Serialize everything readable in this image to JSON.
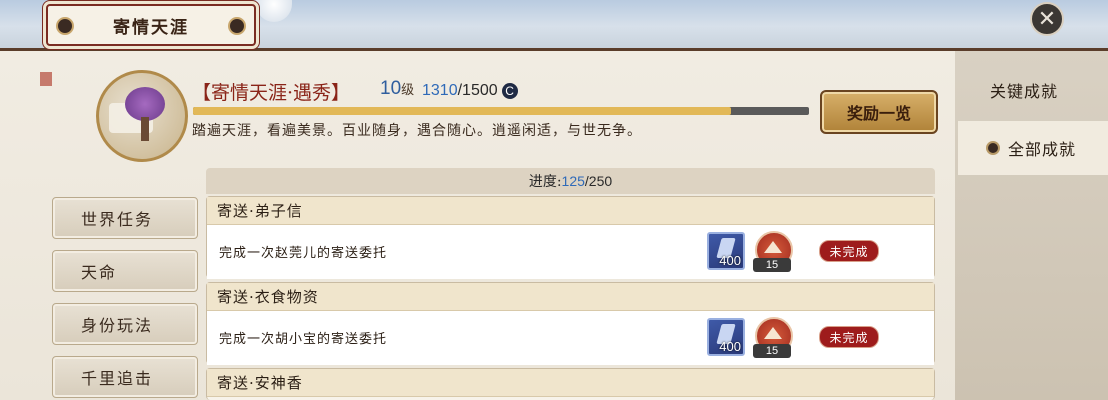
{
  "window": {
    "title": "寄情天涯"
  },
  "achievement": {
    "title": "【寄情天涯·遇秀】",
    "level": "10",
    "level_unit": "级",
    "points_current": "1310",
    "points_max": "/1500",
    "points_icon": "coin-icon",
    "progress_fraction": 0.873,
    "description": "踏遍天涯，看遍美景。百业随身，遇合随心。逍遥闲适，与世无争。",
    "reward_button": "奖励一览"
  },
  "progress": {
    "label": "进度:",
    "current": "125",
    "total": "/250"
  },
  "left_nav": [
    {
      "label": "世界任务"
    },
    {
      "label": "天命"
    },
    {
      "label": "身份玩法"
    },
    {
      "label": "千里追击"
    }
  ],
  "right_tabs": [
    {
      "label": "关键成就"
    },
    {
      "label": "全部成就"
    }
  ],
  "tasks": [
    {
      "title": "寄送·弟子信",
      "desc": "完成一次赵莞儿的寄送委托",
      "reward1_qty": "400",
      "reward2_qty": "15",
      "status": "未完成"
    },
    {
      "title": "寄送·衣食物资",
      "desc": "完成一次胡小宝的寄送委托",
      "reward1_qty": "400",
      "reward2_qty": "15",
      "status": "未完成"
    },
    {
      "title": "寄送·安神香"
    }
  ],
  "colors": {
    "accent_red": "#9e1c1c",
    "progress_gold": "#e2b857",
    "blue_number": "#2f6ab8"
  }
}
